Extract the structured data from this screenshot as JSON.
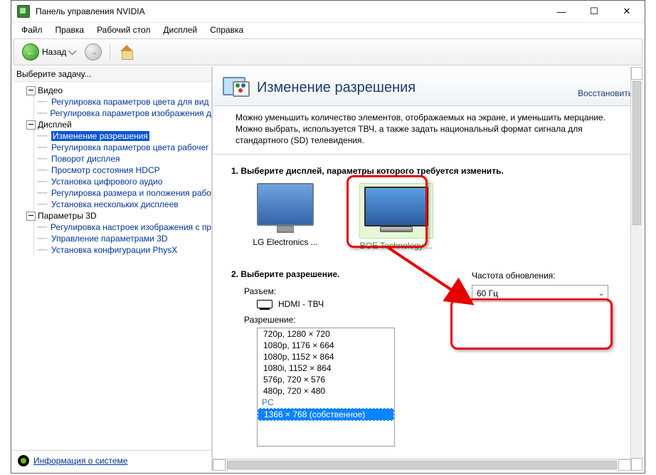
{
  "window_title": "Панель управления NVIDIA",
  "menu": [
    "Файл",
    "Правка",
    "Рабочий стол",
    "Дисплей",
    "Справка"
  ],
  "toolbar": {
    "back": "Назад"
  },
  "left": {
    "title": "Выберите задачу...",
    "tree": {
      "video": {
        "label": "Видео",
        "items": [
          "Регулировка параметров цвета для вид",
          "Регулировка параметров изображения д"
        ]
      },
      "display": {
        "label": "Дисплей",
        "items": [
          "Изменение разрешения",
          "Регулировка параметров цвета рабочег",
          "Поворот дисплея",
          "Просмотр состояния HDCP",
          "Установка цифрового аудио",
          "Регулировка размера и положения рабо",
          "Установка нескольких дисплеев"
        ],
        "selected_index": 0
      },
      "params3d": {
        "label": "Параметры 3D",
        "items": [
          "Регулировка настроек изображения с пр",
          "Управление параметрами 3D",
          "Установка конфигурации PhysX"
        ]
      }
    },
    "footer_link": "Информация о системе"
  },
  "right": {
    "title": "Изменение разрешения",
    "restore": "Восстановить",
    "description": "Можно уменьшить количество элементов, отображаемых на экране, и уменьшить мерцание. Можно выбрать, используется ТВЧ, а также задать национальный формат сигнала для стандартного (SD) телевидения.",
    "section1_title": "1. Выберите дисплей, параметры которого требуется изменить.",
    "displays": [
      {
        "label": "LG Electronics ...",
        "selected": false
      },
      {
        "label": "BOE Technology ...",
        "selected": true
      }
    ],
    "section2_title": "2. Выберите разрешение.",
    "connector_label": "Разъем:",
    "connector_value": "HDMI - ТВЧ",
    "resolution_label": "Разрешение:",
    "resolutions_visible": [
      "720p, 1280 × 720",
      "1080p, 1176 × 664",
      "1080p, 1152 × 864",
      "1080i, 1152 × 864",
      "576p, 720 × 576",
      "480p, 720 × 480"
    ],
    "pc_header": "PC",
    "selected_res": "1366 × 768 (собственное)",
    "refresh_label": "Частота обновления:",
    "refresh_value": "60 Гц"
  }
}
